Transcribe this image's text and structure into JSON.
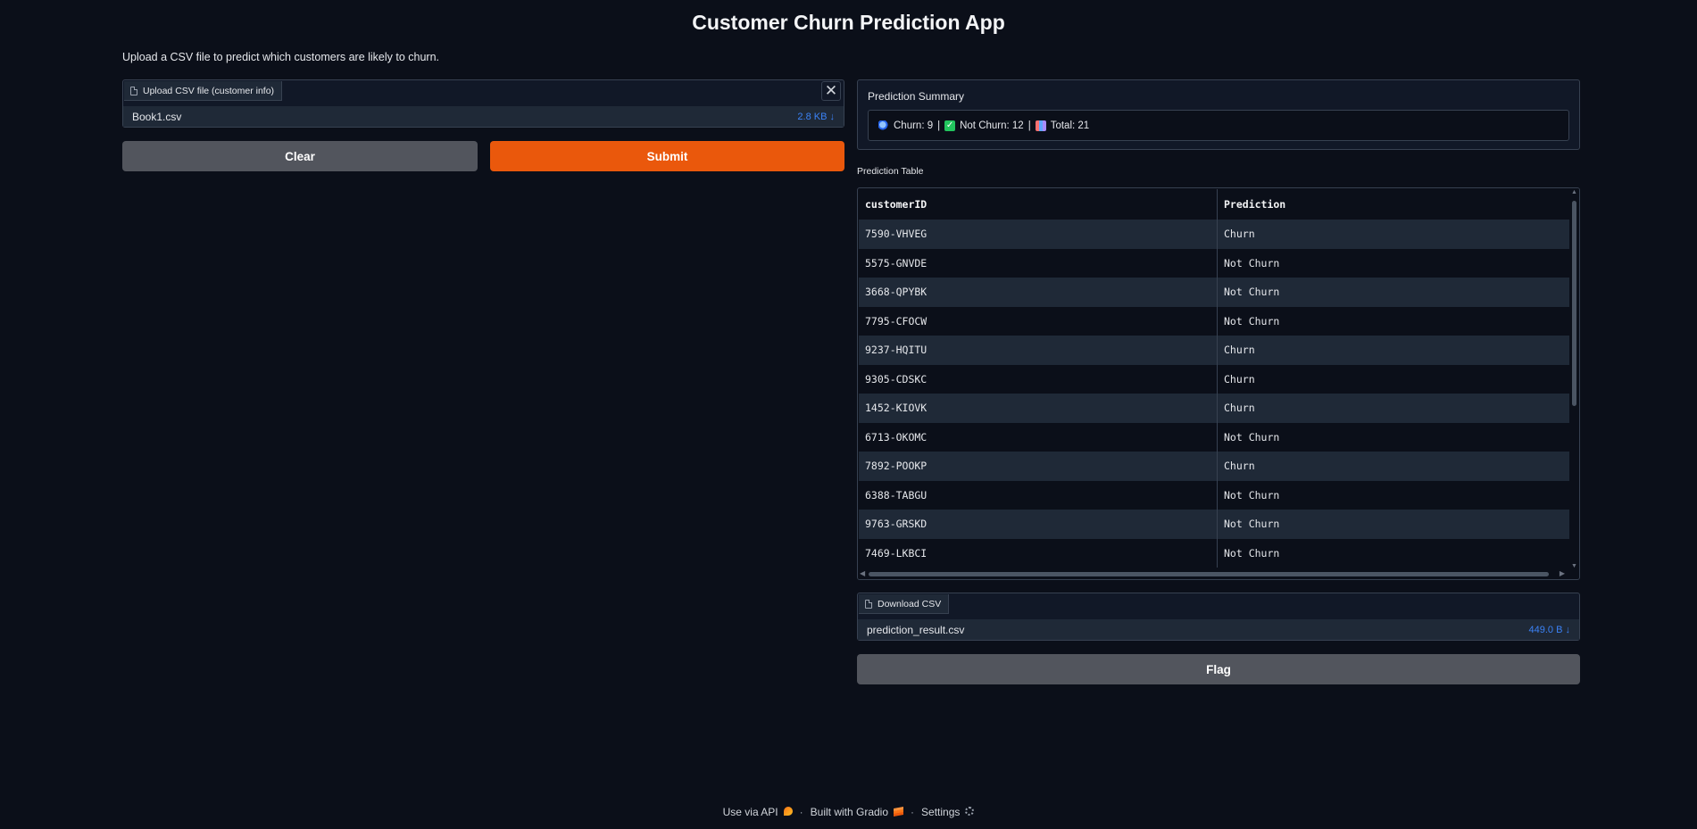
{
  "header": {
    "title": "Customer Churn Prediction App",
    "subtitle": "Upload a CSV file to predict which customers are likely to churn."
  },
  "upload": {
    "label": "Upload CSV file (customer info)",
    "file_name": "Book1.csv",
    "file_size": "2.8 KB ↓",
    "close_symbol": "✕"
  },
  "buttons": {
    "clear": "Clear",
    "submit": "Submit",
    "flag": "Flag"
  },
  "summary": {
    "label": "Prediction Summary",
    "churn": "Churn: 9",
    "not_churn": "Not Churn: 12",
    "total": "Total: 21",
    "separator": "|"
  },
  "table": {
    "label": "Prediction Table",
    "columns": [
      "customerID",
      "Prediction"
    ],
    "rows": [
      [
        "7590-VHVEG",
        "Churn"
      ],
      [
        "5575-GNVDE",
        "Not Churn"
      ],
      [
        "3668-QPYBK",
        "Not Churn"
      ],
      [
        "7795-CFOCW",
        "Not Churn"
      ],
      [
        "9237-HQITU",
        "Churn"
      ],
      [
        "9305-CDSKC",
        "Churn"
      ],
      [
        "1452-KIOVK",
        "Churn"
      ],
      [
        "6713-OKOMC",
        "Not Churn"
      ],
      [
        "7892-POOKP",
        "Churn"
      ],
      [
        "6388-TABGU",
        "Not Churn"
      ],
      [
        "9763-GRSKD",
        "Not Churn"
      ],
      [
        "7469-LKBCI",
        "Not Churn"
      ]
    ]
  },
  "download": {
    "label": "Download CSV",
    "file_name": "prediction_result.csv",
    "file_size": "449.0 B ↓"
  },
  "footer": {
    "api": "Use via API",
    "built": "Built with Gradio",
    "settings": "Settings",
    "dot": "·"
  },
  "colors": {
    "background": "#0b0f19",
    "accent": "#ea580c",
    "link": "#3b82f6"
  }
}
